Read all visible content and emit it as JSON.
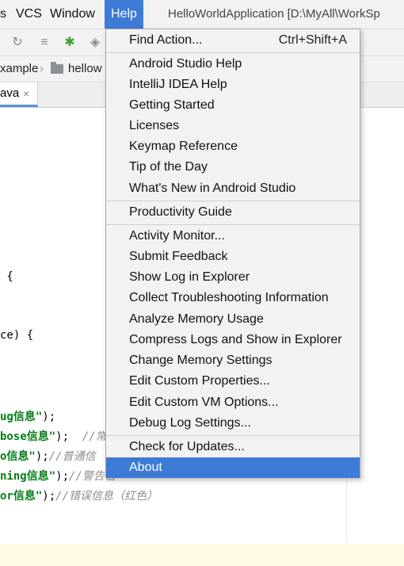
{
  "menubar": {
    "items": [
      "s",
      "VCS",
      "Window",
      "Help"
    ],
    "window_title": "HelloWorldApplication [D:\\MyAll\\WorkSp"
  },
  "breadcrumb": {
    "items": [
      "xample",
      "hellow"
    ]
  },
  "tab": {
    "label": "ava",
    "close": "×"
  },
  "code_lines": [
    {
      "code": " {",
      "string": "",
      "comment": ""
    },
    {
      "code": "ce) {",
      "string": "",
      "comment": ""
    },
    {
      "code": "",
      "string": "ug信息\"",
      "tail": ");",
      "comment": ""
    },
    {
      "code": "",
      "string": "bose信息\"",
      "tail": ");  ",
      "comment": "//常"
    },
    {
      "code": "",
      "string": "o信息\"",
      "tail": ");",
      "comment": "//普通信"
    },
    {
      "code": "",
      "string": "ning信息\"",
      "tail": ");",
      "comment": "//警告信"
    },
    {
      "code": "",
      "string": "or信息\"",
      "tail": ");",
      "comment": "//错误信息（红色）"
    }
  ],
  "help_menu": {
    "items": [
      {
        "label": "Find Action...",
        "shortcut": "Ctrl+Shift+A"
      },
      {
        "label": "Android Studio Help"
      },
      {
        "label": "IntelliJ IDEA Help"
      },
      {
        "label": "Getting Started"
      },
      {
        "label": "Licenses"
      },
      {
        "label": "Keymap Reference"
      },
      {
        "label": "Tip of the Day"
      },
      {
        "label": "What's New in Android Studio"
      },
      {
        "label": "Productivity Guide"
      },
      {
        "label": "Activity Monitor..."
      },
      {
        "label": "Submit Feedback"
      },
      {
        "label": "Show Log in Explorer"
      },
      {
        "label": "Collect Troubleshooting Information"
      },
      {
        "label": "Analyze Memory Usage"
      },
      {
        "label": "Compress Logs and Show in Explorer"
      },
      {
        "label": "Change Memory Settings"
      },
      {
        "label": "Edit Custom Properties..."
      },
      {
        "label": "Edit Custom VM Options..."
      },
      {
        "label": "Debug Log Settings..."
      },
      {
        "label": "Check for Updates..."
      },
      {
        "label": "About"
      }
    ],
    "selected_item": "About"
  },
  "colors": {
    "menu_highlight": "#3d7bd6",
    "string_green": "#067d17",
    "comment_gray": "#8c8c8c"
  }
}
